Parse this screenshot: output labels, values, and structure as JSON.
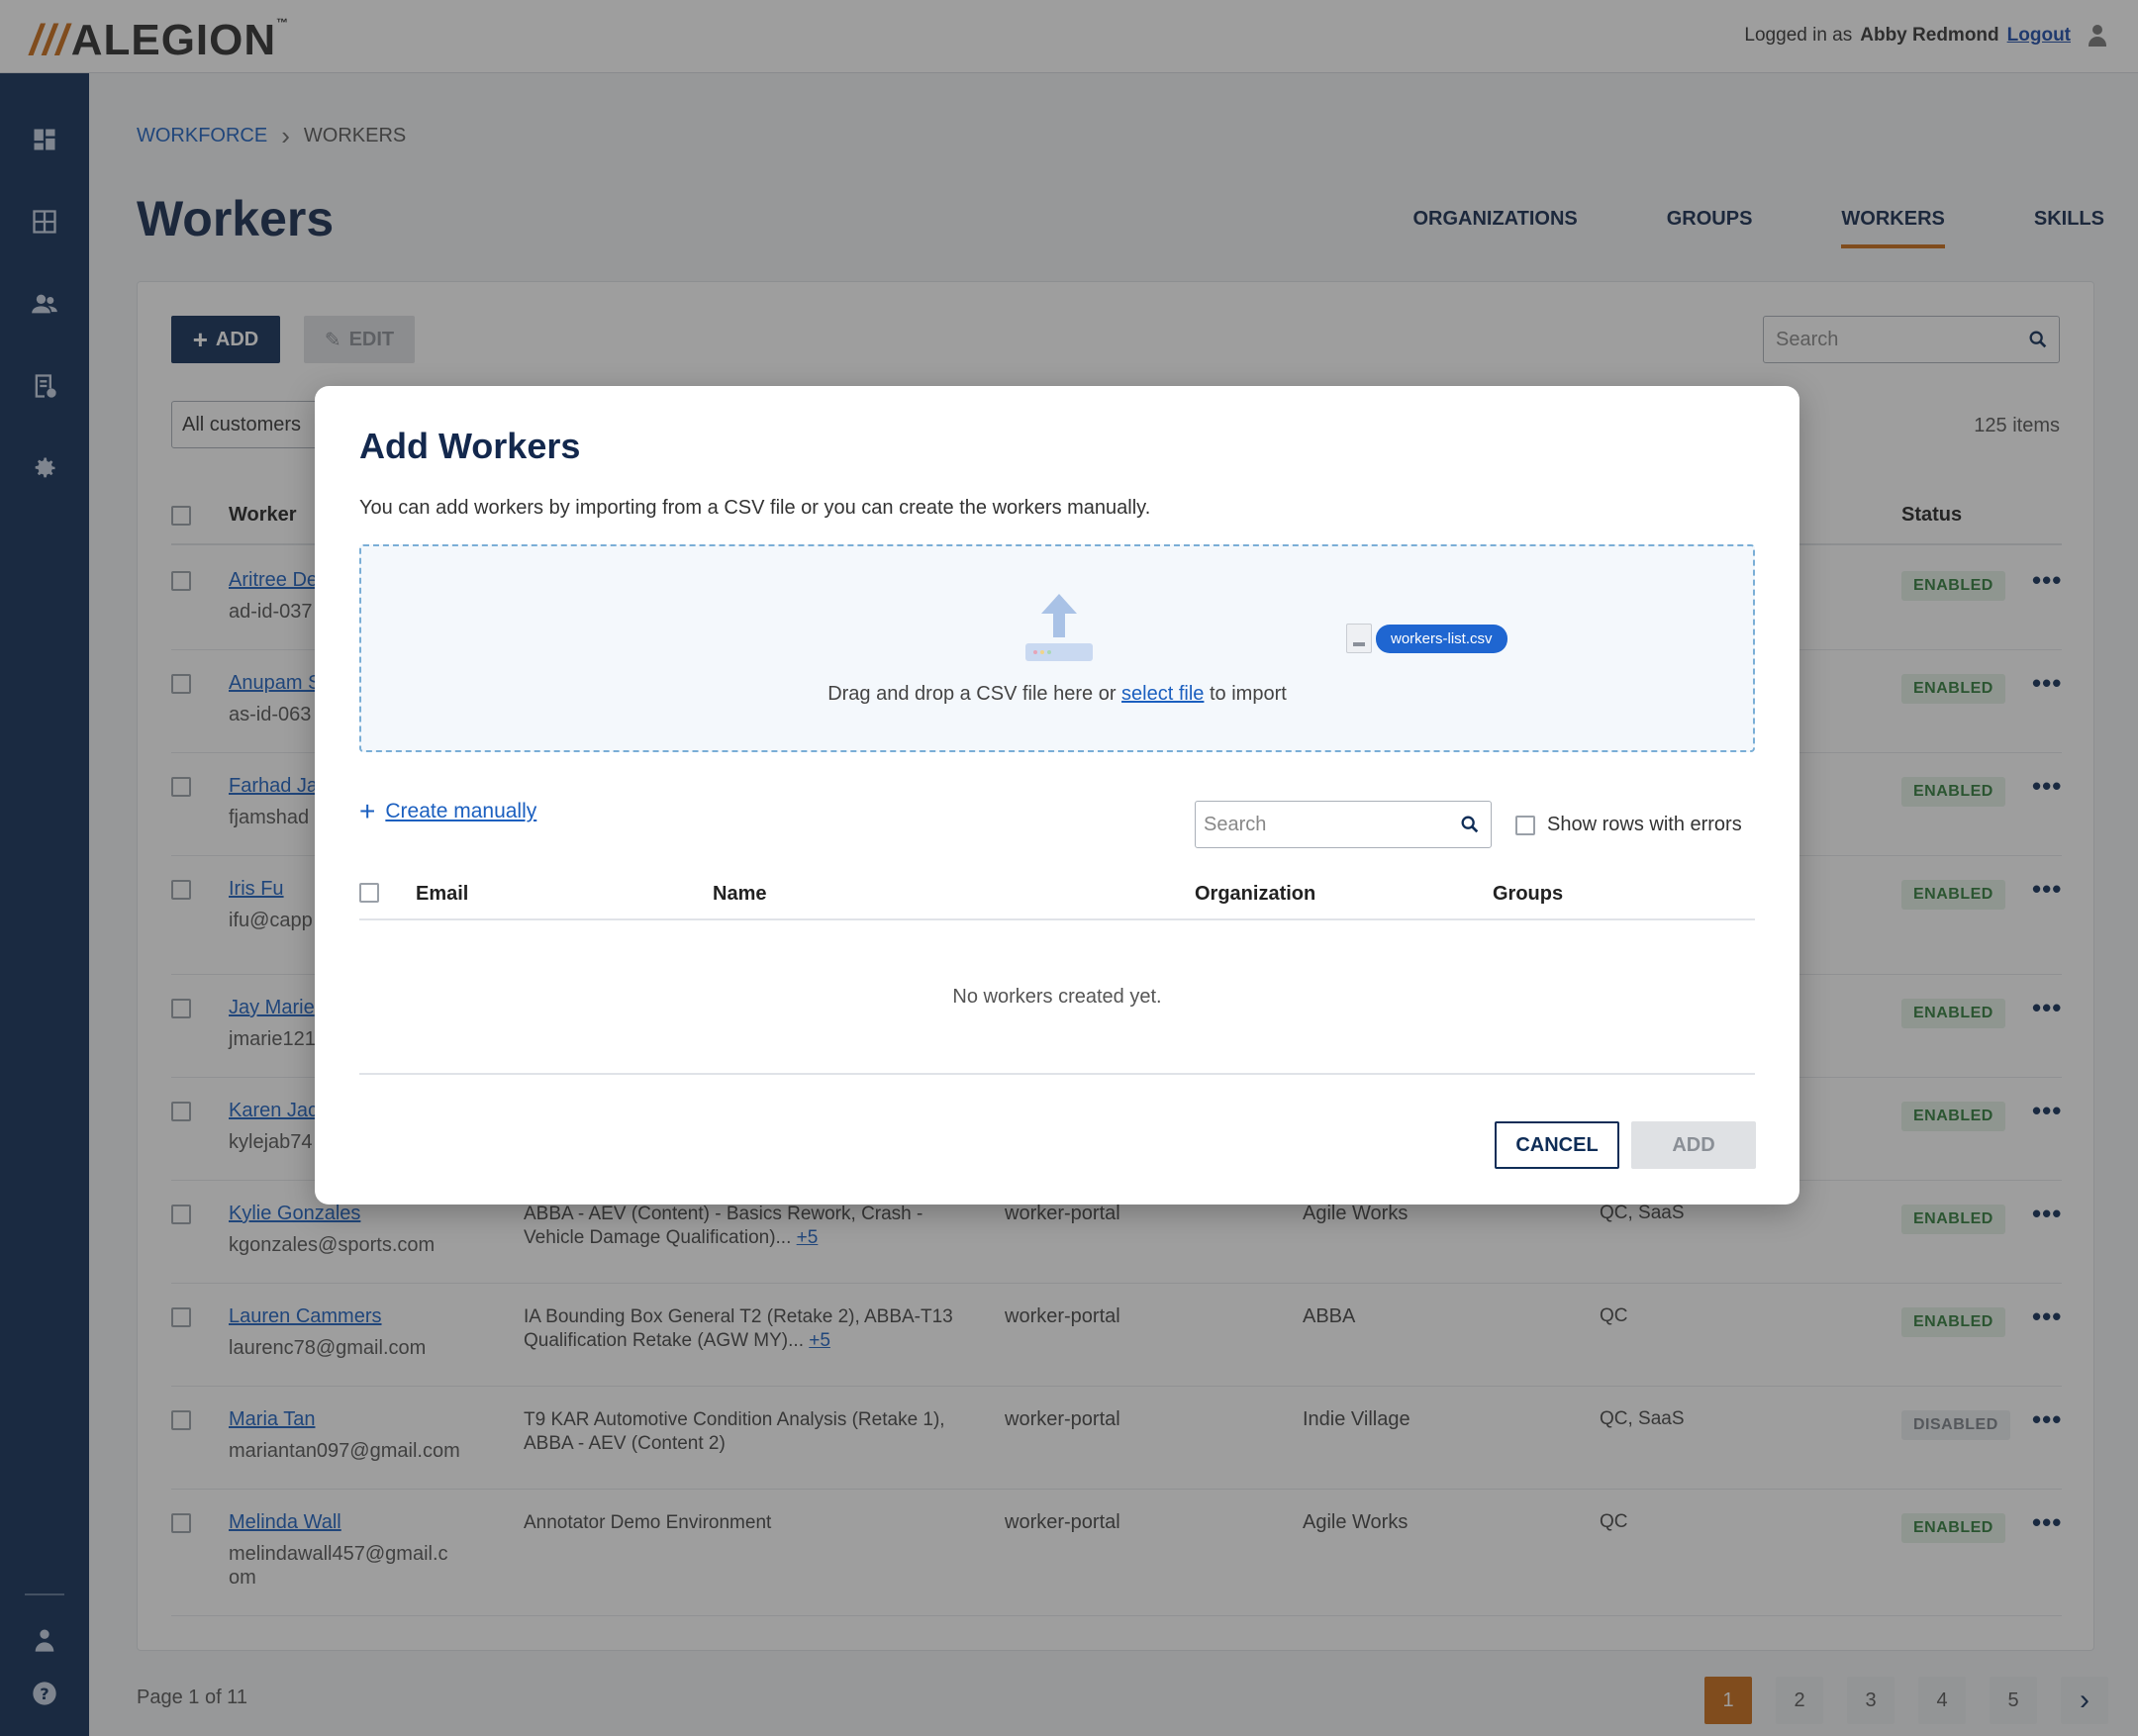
{
  "header": {
    "logo_text": "ALEGION",
    "logo_slashes": "///",
    "logo_tm": "™",
    "logged_in_prefix": "Logged in as",
    "user_name": "Abby Redmond",
    "logout_label": "Logout"
  },
  "breadcrumb": {
    "parent": "WORKFORCE",
    "current": "WORKERS"
  },
  "page": {
    "title": "Workers"
  },
  "tabs": [
    {
      "label": "ORGANIZATIONS"
    },
    {
      "label": "GROUPS"
    },
    {
      "label": "WORKERS",
      "active": true
    },
    {
      "label": "SKILLS"
    }
  ],
  "toolbar": {
    "add_label": "ADD",
    "edit_label": "EDIT",
    "search_placeholder": "Search",
    "filter_value": "All customers",
    "items_count": "125 items"
  },
  "table": {
    "col_worker": "Worker",
    "col_status": "Status",
    "rows": [
      {
        "name": "Kylie Gonzales",
        "email": "kgonzales@sports.com",
        "skills": "ABBA - AEV (Content) - Basics Rework, Crash - Vehicle Damage Qualification)...",
        "more_skills": "+5",
        "portal": "worker-portal",
        "org": "Agile Works",
        "groups": "QC, SaaS",
        "status": "ENABLED"
      },
      {
        "name": "Lauren Cammers",
        "email": "laurenc78@gmail.com",
        "skills": "IA Bounding Box General T2 (Retake 2), ABBA-T13 Qualification Retake (AGW MY)...",
        "more_skills": "+5",
        "portal": "worker-portal",
        "org": "ABBA",
        "groups": "QC",
        "status": "ENABLED"
      },
      {
        "name": "Maria Tan",
        "email": "mariantan097@gmail.com",
        "skills": "T9 KAR Automotive Condition Analysis (Retake 1), ABBA - AEV (Content 2)",
        "more_skills": "",
        "portal": "worker-portal",
        "org": "Indie Village",
        "groups": "QC, SaaS",
        "status": "DISABLED"
      },
      {
        "name": "Melinda Wall",
        "email": "melindawall457@gmail.com",
        "skills": "Annotator Demo Environment",
        "more_skills": "",
        "portal": "worker-portal",
        "org": "Agile Works",
        "groups": "QC",
        "status": "ENABLED"
      }
    ],
    "partial_rows": [
      {
        "name": "Aritree De",
        "email": "ad-id-037",
        "status": "ENABLED"
      },
      {
        "name": "Anupam S",
        "email": "as-id-063",
        "status": "ENABLED"
      },
      {
        "name": "Farhad Ja",
        "email": "fjamshad",
        "status": "ENABLED"
      },
      {
        "name": "Iris Fu",
        "email": "ifu@capp",
        "status": "ENABLED"
      },
      {
        "name": "Jay Marie",
        "email": "jmarie121",
        "status": "ENABLED"
      },
      {
        "name": "Karen Jac",
        "email": "kylejab74",
        "status": "ENABLED"
      }
    ],
    "more_icon": "•••"
  },
  "pagination": {
    "label": "Page 1 of 11",
    "pages": [
      "1",
      "2",
      "3",
      "4",
      "5"
    ],
    "current": "1"
  },
  "modal": {
    "title": "Add Workers",
    "description": "You can add workers by importing from a CSV file or you can create the workers manually.",
    "drop_text_before": "Drag and drop a CSV file here or",
    "drop_link": "select file",
    "drop_text_after": "to import",
    "file_name": "workers-list.csv",
    "create_manually": "Create manually",
    "search_placeholder": "Search",
    "show_errors_label": "Show rows with errors",
    "columns": {
      "email": "Email",
      "name": "Name",
      "organization": "Organization",
      "groups": "Groups"
    },
    "empty_text": "No workers created yet.",
    "cancel_label": "CANCEL",
    "add_label": "ADD"
  },
  "colors": {
    "navy": "#0f2d57",
    "accent_orange": "#c96a14",
    "link_blue": "#1b5fbf",
    "enabled_green": "#2f7a3a"
  }
}
